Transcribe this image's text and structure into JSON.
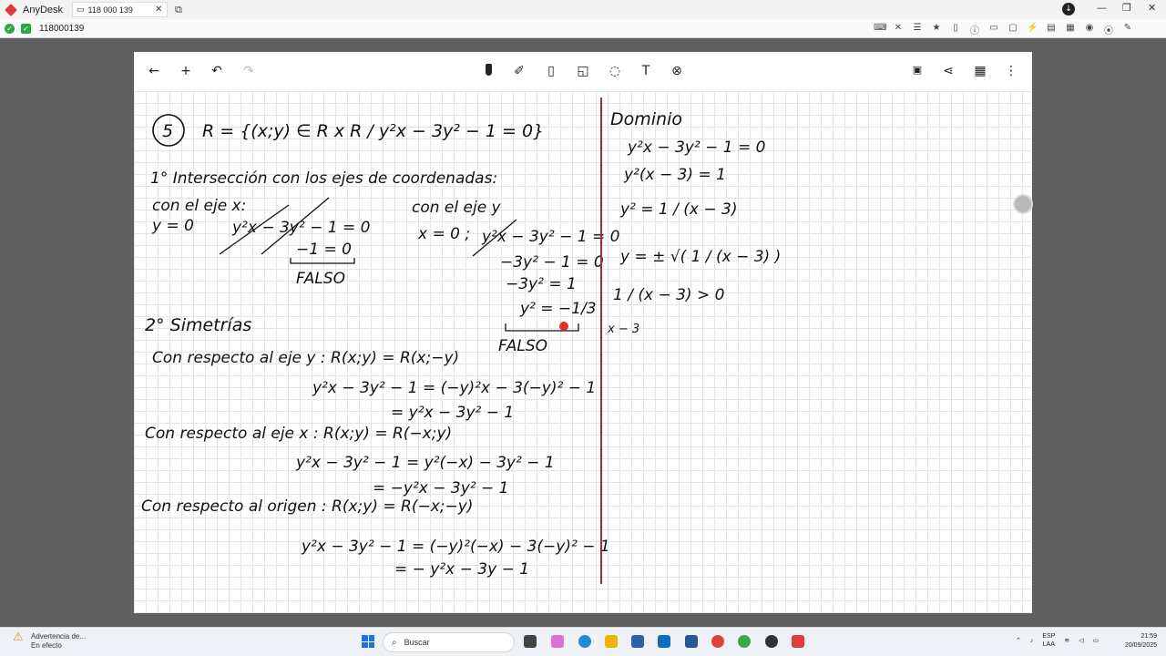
{
  "titlebar": {
    "app_name": "AnyDesk",
    "tab_label": "118 000 139",
    "tab_close": "✕"
  },
  "address": {
    "id_text": "118000139"
  },
  "notebook_toolbar": {
    "icons": [
      "back-arrow-icon",
      "add-icon",
      "undo-icon",
      "redo-icon",
      "pen-icon",
      "marker-icon",
      "highlighter-icon",
      "lasso-icon",
      "shapes-icon",
      "text-icon",
      "eraser-icon",
      "ai-icon",
      "share-icon",
      "grid-icon",
      "more-icon"
    ]
  },
  "notes": {
    "ex_number": "5",
    "relation": "R = {(x;y) ∈ R x R / y²x − 3y² − 1 = 0}",
    "step1": "1° Intersección con los ejes de coordenadas:",
    "eje_x_label": "con el eje x:",
    "eje_x_y0": "y = 0",
    "eje_x_eq": "y²x − 3y² − 1 = 0",
    "eje_x_res": "−1 = 0",
    "falso1": "FALSO",
    "eje_y_label": "con el eje y",
    "eje_y_x0": "x = 0 ;",
    "eje_y_eq": "y²x − 3y² − 1 = 0",
    "eje_y_l1": "−3y² − 1 = 0",
    "eje_y_l2": "−3y² = 1",
    "eje_y_l3": "y² = −1/3",
    "falso2": "FALSO",
    "step2": "2° Simetrías",
    "sym_y_label": "Con respecto al eje y : R(x;y) = R(x;−y)",
    "sym_y_l1": "y²x − 3y² − 1 = (−y)²x − 3(−y)² − 1",
    "sym_y_l2": "= y²x − 3y² − 1",
    "sym_x_label": "Con respecto al eje x : R(x;y) = R(−x;y)",
    "sym_x_l1": "y²x − 3y² − 1 = y²(−x) − 3y² − 1",
    "sym_x_l2": "= −y²x − 3y² − 1",
    "sym_o_label": "Con respecto al origen : R(x;y) = R(−x;−y)",
    "sym_o_l1": "y²x − 3y² − 1 = (−y)²(−x) − 3(−y)² − 1",
    "sym_o_l2": "= − y²x − 3y − 1",
    "dom_title": "Dominio",
    "dom_l1": "y²x − 3y² − 1 = 0",
    "dom_l2": "y²(x − 3) = 1",
    "dom_l3": "y² = 1 / (x − 3)",
    "dom_l4": "y = ± √( 1 / (x − 3) )",
    "dom_l5": "1 / (x − 3) > 0",
    "dom_l6": "x − 3"
  },
  "taskbar": {
    "warning_title": "Advertencia de...",
    "warning_sub": "En efecto",
    "search_placeholder": "Buscar",
    "lang_1": "ESP",
    "lang_2": "LAA",
    "time": "21:59",
    "date": "20/09/2025"
  },
  "colors": {
    "divider": "#b3262e",
    "ink": "#111111",
    "laser": "#e0302c",
    "accent": "#1a73e8"
  }
}
